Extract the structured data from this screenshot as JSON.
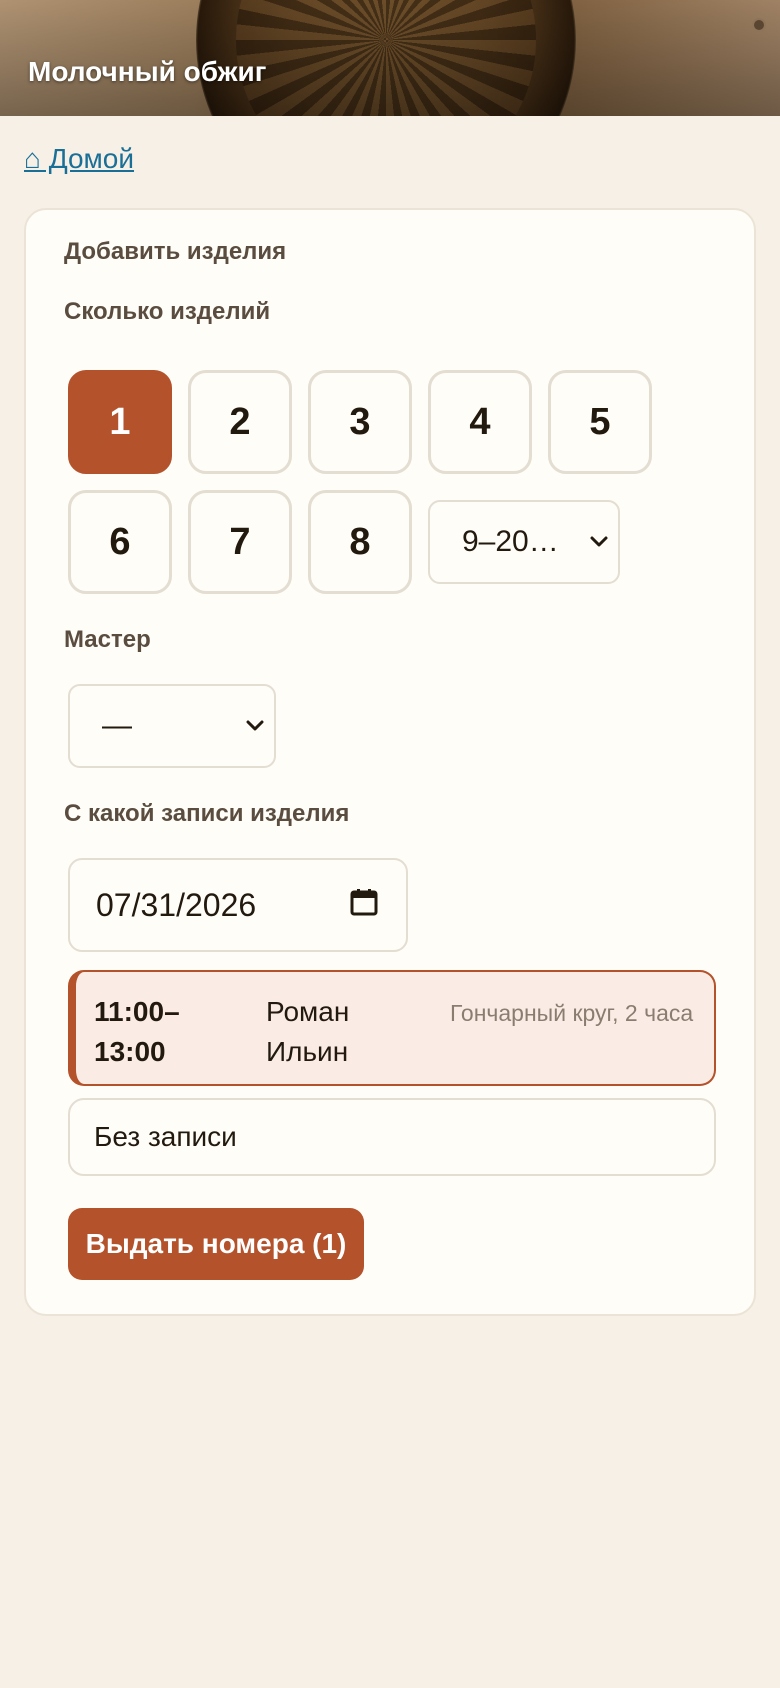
{
  "header": {
    "title": "Молочный обжиг"
  },
  "nav": {
    "home_label": "⌂ Домой"
  },
  "form": {
    "section_title": "Добавить изделия",
    "quantity_label": "Сколько изделий",
    "quantity_options": [
      "1",
      "2",
      "3",
      "4",
      "5",
      "6",
      "7",
      "8"
    ],
    "quantity_selected": "1",
    "quantity_more_select": "9–20…",
    "master_label": "Мастер",
    "master_value": "—",
    "booking_label": "С какой записи изделия",
    "date_value": "07/31/2026",
    "booking": {
      "time": "11:00–13:00",
      "master": "Роман Ильин",
      "service": "Гончарный круг, 2 часа"
    },
    "no_booking_label": "Без записи",
    "submit_label": "Выдать номера (1)"
  },
  "colors": {
    "accent": "#b3522b",
    "link": "#1a6f96",
    "background": "#f6f0e7",
    "card": "#fffdf7"
  }
}
